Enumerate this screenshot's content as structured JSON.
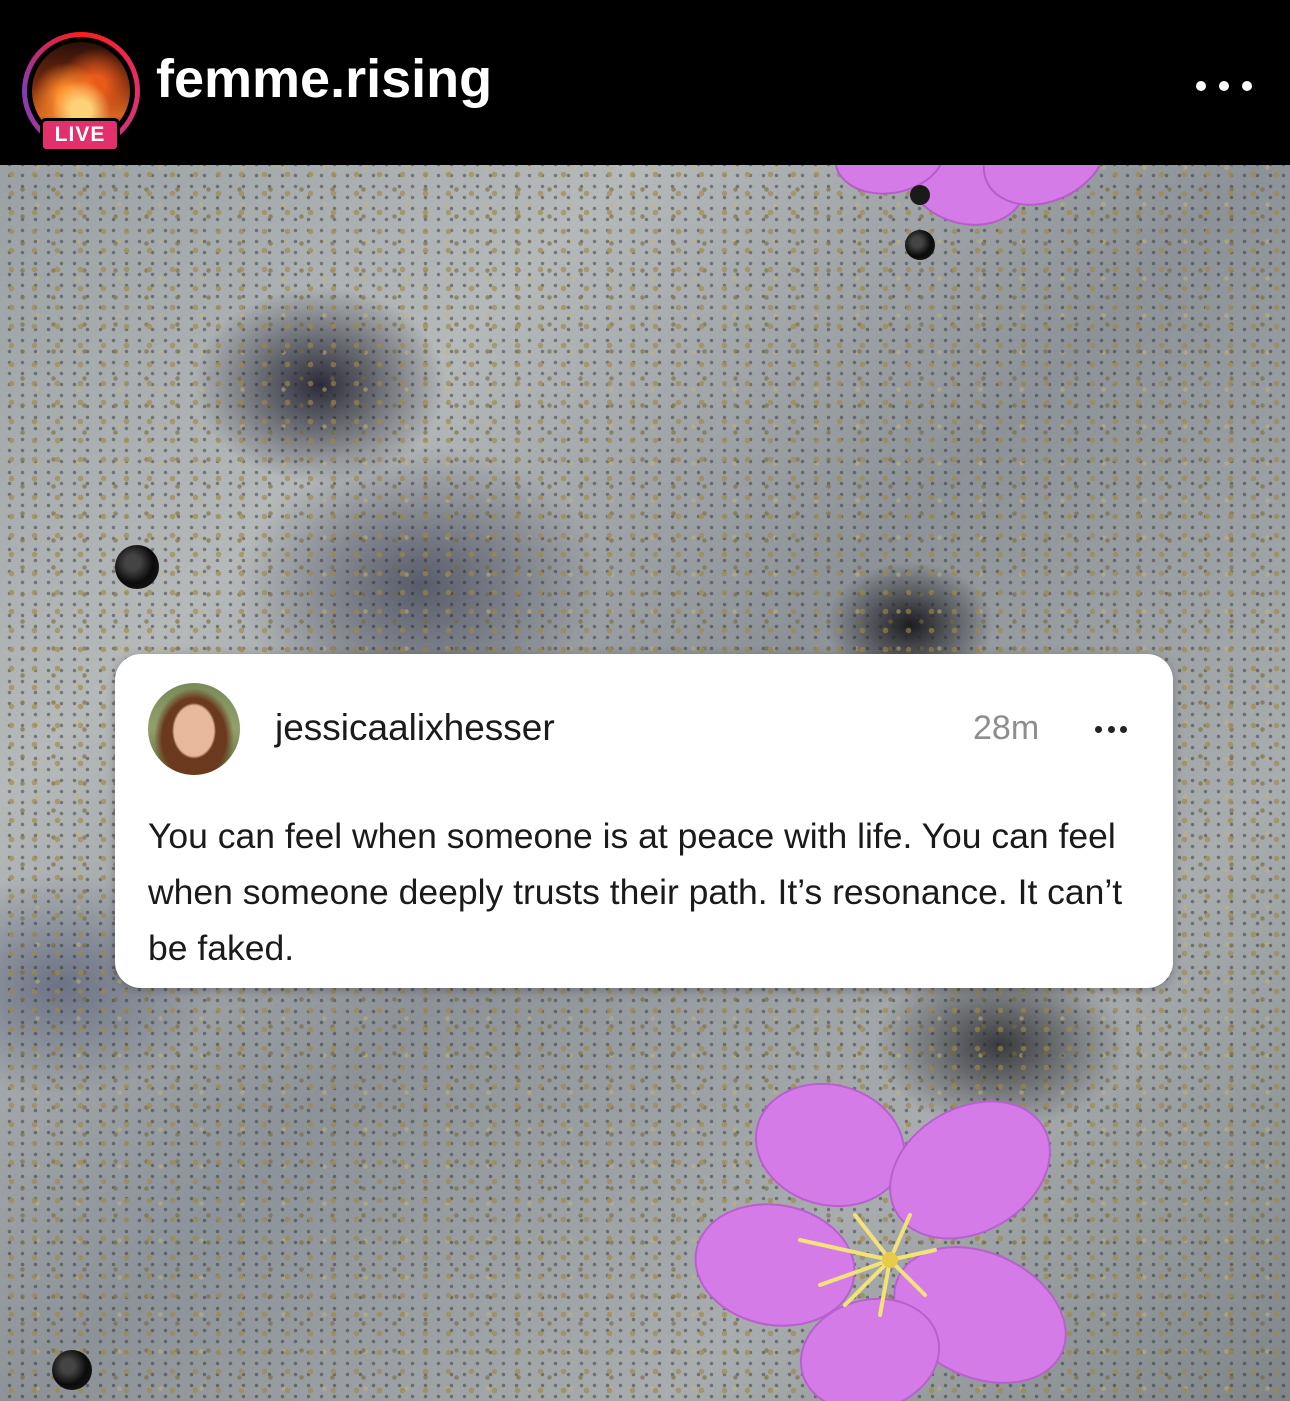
{
  "header": {
    "username": "femme.rising",
    "live_badge": "LIVE",
    "more_icon": "more-horizontal-icon"
  },
  "colors": {
    "live_badge": "#e1306c",
    "header_bg": "#000000",
    "card_bg": "#ffffff",
    "flower": "#d57be8"
  },
  "post": {
    "username": "jessicaalixhesser",
    "time": "28m",
    "more_icon": "more-horizontal-icon",
    "text": "You can feel when someone is at peace with life. You can feel when someone deeply trusts their path. It’s resonance. It can’t be faked."
  }
}
